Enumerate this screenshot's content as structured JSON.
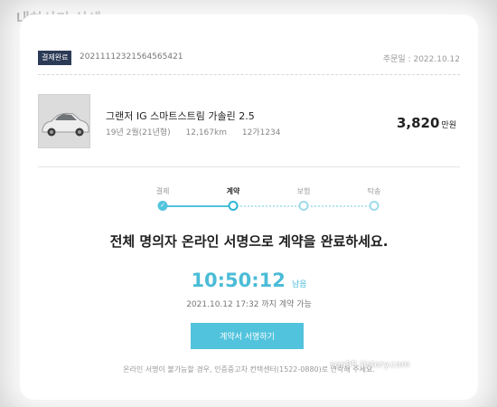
{
  "page": {
    "title": "내차사기 상세"
  },
  "order": {
    "badge": "결제완료",
    "number": "20211112321564565421",
    "date": "주문일 : 2022.10.12"
  },
  "car": {
    "name": "그랜저 IG 스마트스트림 가솔린 2.5",
    "year": "19년 2월(21년형)",
    "mileage": "12,167km",
    "plate": "12가1234",
    "price": "3,820",
    "price_unit": "만원"
  },
  "steps": [
    {
      "label": "결제",
      "state": "done"
    },
    {
      "label": "계약",
      "state": "current"
    },
    {
      "label": "보험",
      "state": "pending"
    },
    {
      "label": "탁송",
      "state": "pending"
    }
  ],
  "headline": "전체 명의자 온라인 서명으로 계약을 완료하세요.",
  "timer": {
    "time": "10:50:12",
    "suffix": "남음"
  },
  "deadline": "2021.10.12 17:32 까지 계약 가능",
  "sign_button": "계약서 서명하기",
  "notice": "온라인 서명이 불가능할 경우, 인증중고차 컨택센터(1522-0880)로 연락해 주세요.",
  "watermark": "son95.tistory.com",
  "colors": {
    "accent": "#52c3dd",
    "badge": "#2b3a55"
  }
}
